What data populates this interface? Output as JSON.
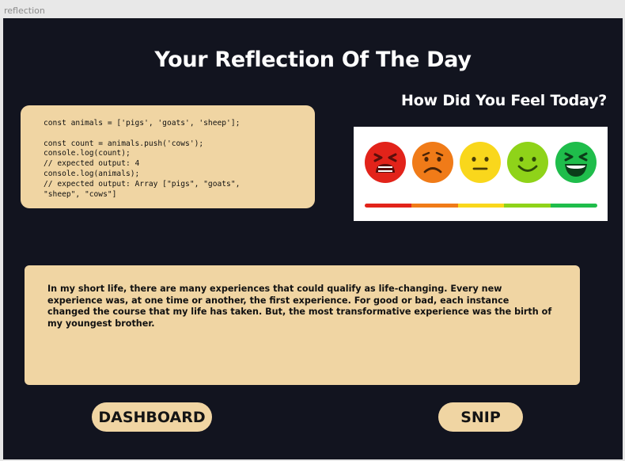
{
  "window": {
    "title": "reflection"
  },
  "page": {
    "title": "Your Reflection Of The Day",
    "feel_heading": "How Did You Feel Today?"
  },
  "code": {
    "text": "const animals = ['pigs', 'goats', 'sheep'];\n\nconst count = animals.push('cows');\nconsole.log(count);\n// expected output: 4\nconsole.log(animals);\n// expected output: Array [\"pigs\", \"goats\",\n\"sheep\", \"cows\"]"
  },
  "mood": {
    "faces": [
      {
        "icon": "furious-face-icon",
        "color": "#e2231a"
      },
      {
        "icon": "sad-face-icon",
        "color": "#f07b18"
      },
      {
        "icon": "neutral-face-icon",
        "color": "#f9d71c"
      },
      {
        "icon": "smiling-face-icon",
        "color": "#8fd319"
      },
      {
        "icon": "laughing-face-icon",
        "color": "#1fbd4b"
      }
    ],
    "bar_colors": [
      "#e2231a",
      "#f07b18",
      "#f9d71c",
      "#8fd319",
      "#1fbd4b"
    ]
  },
  "reflection": {
    "text": "In my short life, there are many experiences that could qualify as life-changing. Every new experience was, at one time or another, the first experience. For good or bad, each instance changed the course that my life has taken. But, the most transformative experience was the birth of my youngest brother."
  },
  "buttons": {
    "dashboard": "DASHBOARD",
    "snip": "SNIP"
  },
  "colors": {
    "background": "#12141f",
    "card": "#f0d5a3"
  }
}
